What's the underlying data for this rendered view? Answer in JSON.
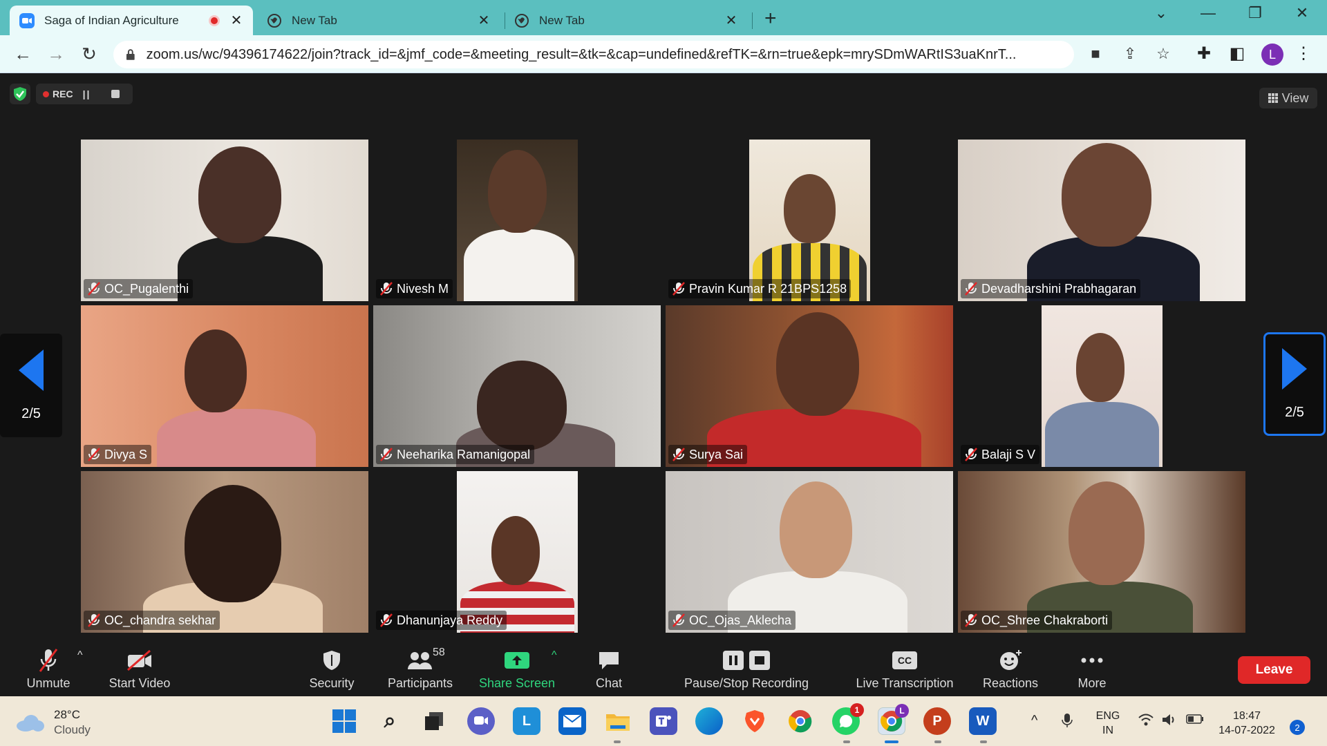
{
  "browser": {
    "tabs": [
      {
        "title": "Saga of Indian Agriculture",
        "active": true
      },
      {
        "title": "New Tab",
        "active": false
      },
      {
        "title": "New Tab",
        "active": false
      }
    ],
    "url": "zoom.us/wc/94396174622/join?track_id=&jmf_code=&meeting_result=&tk=&cap=undefined&refTK=&rn=true&epk=mrySDmWARtIS3uaKnrT...",
    "profile_initial": "L"
  },
  "meeting": {
    "rec_label": "REC",
    "view_label": "View",
    "page_indicator": "2/5",
    "participants": [
      {
        "name": "OC_Pugalenthi"
      },
      {
        "name": "Nivesh M"
      },
      {
        "name": "Pravin Kumar R 21BPS1258"
      },
      {
        "name": "Devadharshini Prabhagaran"
      },
      {
        "name": "Divya S"
      },
      {
        "name": "Neeharika Ramanigopal"
      },
      {
        "name": "Surya Sai"
      },
      {
        "name": "Balaji S V"
      },
      {
        "name": "OC_chandra sekhar"
      },
      {
        "name": "Dhanunjaya Reddy"
      },
      {
        "name": "OC_Ojas_Aklecha"
      },
      {
        "name": "OC_Shree Chakraborti"
      }
    ]
  },
  "toolbar": {
    "unmute": "Unmute",
    "start_video": "Start Video",
    "security": "Security",
    "participants": "Participants",
    "participant_count": "58",
    "share_screen": "Share Screen",
    "chat": "Chat",
    "recording": "Pause/Stop Recording",
    "transcription": "Live Transcription",
    "cc_label": "CC",
    "reactions": "Reactions",
    "more": "More",
    "leave": "Leave"
  },
  "taskbar": {
    "temperature": "28°C",
    "weather": "Cloudy",
    "lang_primary": "ENG",
    "lang_secondary": "IN",
    "time": "18:47",
    "date": "14-07-2022",
    "notifications": "2",
    "whatsapp_badge": "1",
    "word_letter": "W",
    "ppt_letter": "P",
    "launcher_letter": "L"
  },
  "colors": {
    "accent_blue": "#1d76f0",
    "share_green": "#2fd67e",
    "leave_red": "#e02828",
    "tabbar": "#5bbfbf"
  }
}
